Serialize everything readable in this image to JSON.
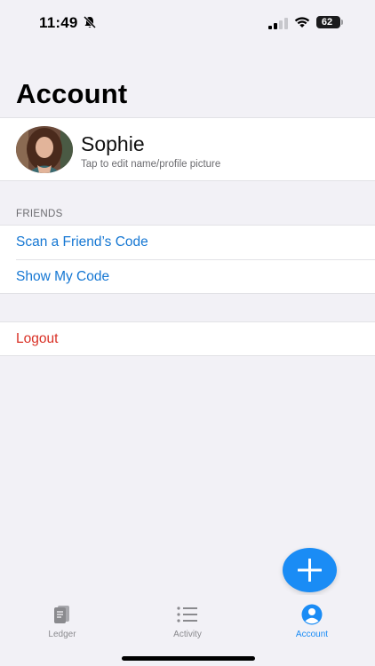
{
  "status_bar": {
    "time": "11:49",
    "battery": "62"
  },
  "page": {
    "title": "Account"
  },
  "profile": {
    "name": "Sophie",
    "hint": "Tap to edit name/profile picture"
  },
  "friends": {
    "header": "FRIENDS",
    "items": [
      {
        "label": "Scan a Friend’s Code"
      },
      {
        "label": "Show My Code"
      }
    ]
  },
  "logout": {
    "label": "Logout"
  },
  "tab_bar": {
    "tabs": [
      {
        "label": "Ledger",
        "icon": "ledger-icon"
      },
      {
        "label": "Activity",
        "icon": "list-icon"
      },
      {
        "label": "Account",
        "icon": "person-circle-icon",
        "active": true
      }
    ]
  },
  "colors": {
    "accent": "#1a8cf5",
    "link": "#1577d3",
    "destructive": "#d93025",
    "background": "#f2f1f6"
  }
}
